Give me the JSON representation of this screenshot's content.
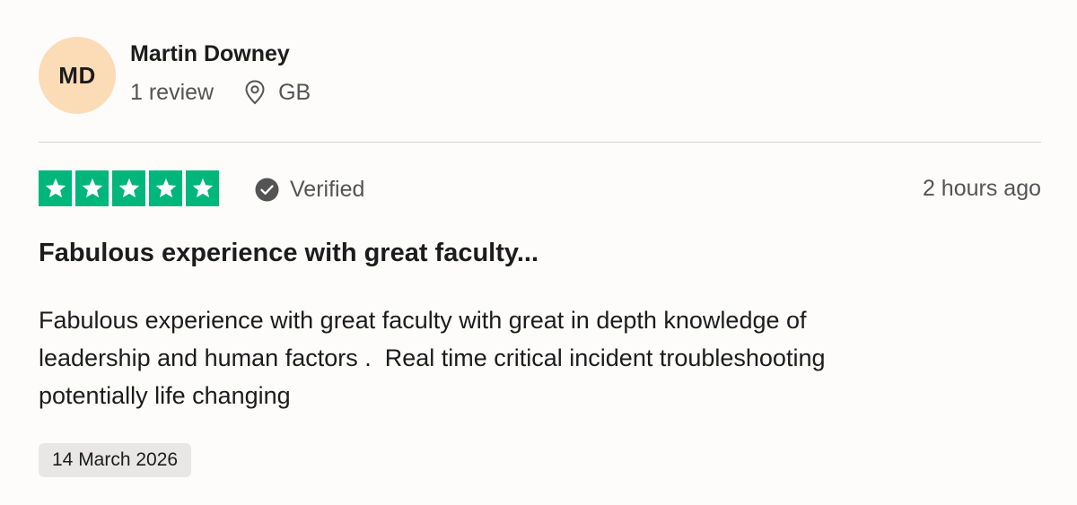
{
  "reviewer": {
    "initials": "MD",
    "name": "Martin Downey",
    "review_count": "1 review",
    "country": "GB",
    "avatar_color": "#fcdcb6",
    "location_icon": "location-pin-icon"
  },
  "review": {
    "rating": 5,
    "rating_max": 5,
    "star_color": "#00b67a",
    "verified_label": "Verified",
    "verified_icon": "check-circle-icon",
    "posted": "2 hours ago",
    "title": "Fabulous experience with great faculty...",
    "body": "Fabulous experience with great faculty with great in depth knowledge of\nleadership and human factors .  Real time critical incident troubleshooting\npotentially life changing",
    "date_of_experience": "14 March 2026"
  }
}
